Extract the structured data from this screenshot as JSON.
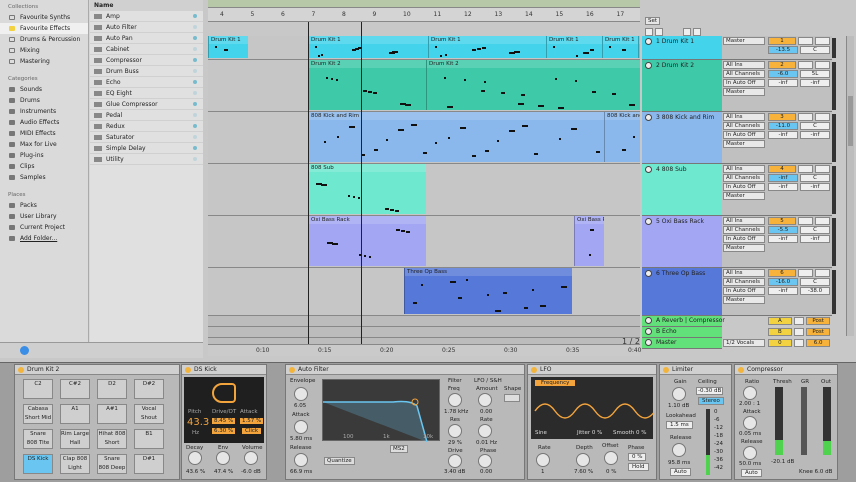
{
  "browser": {
    "collections_title": "Collections",
    "collections": [
      "Favourite Synths",
      "Favourite Effects",
      "Drums & Percussion",
      "Mixing",
      "Mastering"
    ],
    "categories_title": "Categories",
    "categories": [
      "Sounds",
      "Drums",
      "Instruments",
      "Audio Effects",
      "MIDI Effects",
      "Max for Live",
      "Plug-ins",
      "Clips",
      "Samples"
    ],
    "places_title": "Places",
    "places": [
      "Packs",
      "User Library",
      "Current Project",
      "Add Folder..."
    ],
    "name_header": "Name",
    "effects": [
      "Amp",
      "Auto Filter",
      "Auto Pan",
      "Cabinet",
      "Compressor",
      "Drum Buss",
      "Echo",
      "EQ Eight",
      "Glue Compressor",
      "Pedal",
      "Redux",
      "Saturator",
      "Simple Delay",
      "Utility"
    ]
  },
  "ruler": {
    "bars": [
      "4",
      "5",
      "6",
      "7",
      "8",
      "9",
      "10",
      "11",
      "12",
      "13",
      "14",
      "15",
      "16",
      "17"
    ],
    "times": [
      "0:10",
      "0:15",
      "0:20",
      "0:25",
      "0:30",
      "0:35",
      "0:40"
    ],
    "set_label": "Set",
    "page_indicator": "1 / 2"
  },
  "tracks": [
    {
      "name": "1 Drum Kit 1",
      "num": "1",
      "color": "#43d3ea",
      "io": [
        "Master"
      ],
      "vol": "-13.5",
      "pan": "C",
      "sends": [
        "-inf",
        "-inf"
      ],
      "clips": [
        "Drum Kit 1",
        "Drum Kit 1",
        "Drum Kit 1",
        "Drum Kit 1",
        "Drum Kit 1",
        "Drum Kit 1"
      ]
    },
    {
      "name": "2 Drum Kit 2",
      "num": "2",
      "color": "#3ec9a8",
      "io": [
        "All Ins",
        "All Channels",
        "In Auto Off",
        "Master"
      ],
      "vol": "-6.0",
      "pan": "5L",
      "sends": [
        "-inf",
        "-inf"
      ],
      "clips": [
        "Drum Kit 2",
        "Drum Kit 2",
        "Drum Kit 2"
      ]
    },
    {
      "name": "3 808 Kick and Rim",
      "num": "3",
      "color": "#8ab8ec",
      "io": [
        "All Ins",
        "All Channels",
        "In Auto Off",
        "Master"
      ],
      "vol": "-11.0",
      "pan": "C",
      "sends": [
        "-inf",
        "-inf"
      ],
      "clips": [
        "808 Kick and Rim",
        "808 Kick and Rim"
      ]
    },
    {
      "name": "4 808 Sub",
      "num": "4",
      "color": "#6ee8cf",
      "io": [
        "All Ins",
        "All Channels",
        "In Auto Off",
        "Master"
      ],
      "vol": "-inf",
      "pan": "C",
      "sends": [
        "-inf",
        "-inf"
      ],
      "clips": [
        "808 Sub"
      ]
    },
    {
      "name": "5 Oxi Bass Rack",
      "num": "5",
      "color": "#a3a6f3",
      "io": [
        "All Ins",
        "All Channels",
        "In Auto Off",
        "Master"
      ],
      "vol": "-5.5",
      "pan": "C",
      "sends": [
        "-inf",
        "-inf"
      ],
      "clips": [
        "Oxi Bass Rack",
        "Oxi Bass Rack"
      ]
    },
    {
      "name": "6 Three Op Bass",
      "num": "6",
      "color": "#5678d8",
      "io": [
        "All Ins",
        "All Channels",
        "In Auto Off",
        "Master"
      ],
      "vol": "-16.0",
      "pan": "C",
      "sends": [
        "-inf",
        "-38.0"
      ],
      "clips": [
        "Three Op Bass"
      ]
    }
  ],
  "returns": [
    {
      "name": "A Reverb | Compressor",
      "letter": "A",
      "post": "Post"
    },
    {
      "name": "B Echo",
      "letter": "B",
      "post": "Post"
    },
    {
      "name": "Master",
      "letter": "0",
      "post": "6.0",
      "io": "1/2 Vocals"
    }
  ],
  "devices": {
    "rack": {
      "title": "Drum Kit 2",
      "pads": [
        "C2",
        "C#2",
        "D2",
        "D#2",
        "Cabasa Short Mid",
        "A1",
        "A#1",
        "Vocal Shout Wha",
        "Snare 808 Tite",
        "Rim Large Hall",
        "Hihat 808 Short",
        "B1",
        "DS Kick",
        "Clap 808 Light",
        "Snare 808 Deep",
        "D#1"
      ]
    },
    "ds_kick": {
      "title": "DS Kick",
      "pitch_label": "Pitch",
      "pitch": "43.3",
      "pitch_unit": "Hz",
      "drive_label": "Drive/OT",
      "drive": "8.45 %",
      "drive2": "6.30 %",
      "attack_label": "Attack",
      "attack": "1.57 %",
      "click": "Click",
      "decay_label": "Decay",
      "decay": "43.6 %",
      "env_label": "Env",
      "env": "47.4 %",
      "volume_label": "Volume",
      "volume": "-6.0 dB"
    },
    "auto_filter": {
      "title": "Auto Filter",
      "envelope": "Envelope",
      "env_val": "6.05",
      "attack_label": "Attack",
      "attack": "5.80 ms",
      "release_label": "Release",
      "release": "66.9 ms",
      "filter": "Filter",
      "freq_label": "Freq",
      "freq": "1.78 kHz",
      "res_label": "Res",
      "res": "29 %",
      "drive_label": "Drive",
      "drive": "3.40 dB",
      "lfo": "LFO / S&H",
      "amount_label": "Amount",
      "amount": "0.00",
      "rate_label": "Rate",
      "rate": "0.01 Hz",
      "phase_label": "Phase",
      "phase": "0.00",
      "shape": "Shape",
      "quantize": "Quantize",
      "ms2": "MS2",
      "ticks": [
        "100",
        "1k",
        "10k"
      ]
    },
    "lfo": {
      "title": "LFO",
      "frequency": "Frequency",
      "wave": "Sine",
      "jitter": "Jitter 0 %",
      "smooth": "Smooth 0 %",
      "rate_label": "Rate",
      "rate": "1",
      "depth_label": "Depth",
      "depth": "7.60 %",
      "offset_label": "Offset",
      "offset": "0 %",
      "phase_label": "Phase",
      "phase": "0 %",
      "hold": "Hold"
    },
    "limiter": {
      "title": "Limiter",
      "gain_label": "Gain",
      "gain": "1.10 dB",
      "ceiling_label": "Ceiling",
      "ceiling": "-0.30 dB",
      "stereo": "Stereo",
      "lookahead_label": "Lookahead",
      "lookahead": "1.5 ms",
      "release_label": "Release",
      "release": "95.8 ms",
      "auto": "Auto",
      "scale": [
        "0",
        "-6",
        "-12",
        "-18",
        "-24",
        "-30",
        "-36",
        "-42"
      ]
    },
    "compressor": {
      "title": "Compressor",
      "ratio_label": "Ratio",
      "ratio": "2.00 : 1",
      "attack_label": "Attack",
      "attack": "0.05 ms",
      "release_label": "Release",
      "release": "50.0 ms",
      "auto": "Auto",
      "thresh": "Thresh",
      "gr": "GR",
      "out": "Out",
      "thresh_val": "-20.1 dB",
      "makeup": "Knee 6.0 dB"
    }
  },
  "colors": {
    "accent": "#f3a43c",
    "selection": "#6ac6f0"
  }
}
